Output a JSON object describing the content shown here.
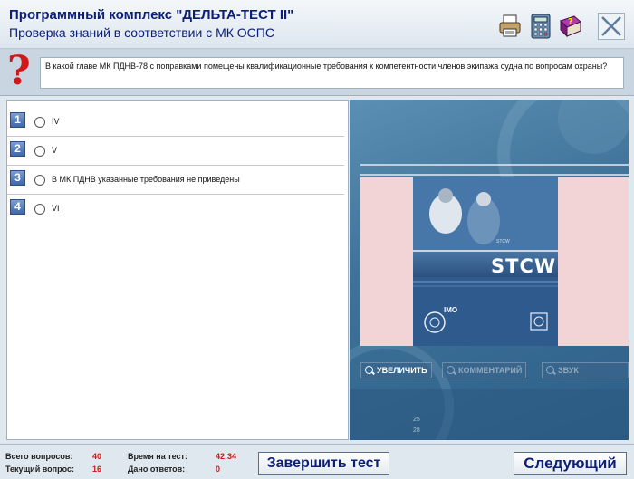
{
  "header": {
    "title": "Программный комплекс \"ДЕЛЬТА-ТЕСТ II\"",
    "subtitle": "Проверка знаний в соответствии с МК ОСПС"
  },
  "question": {
    "text": "В какой главе МК ПДНВ-78 с поправками помещены квалификационные требования к компетентности членов экипажа судна по вопросам охраны?"
  },
  "answers": [
    {
      "num": "1",
      "text": "IV"
    },
    {
      "num": "2",
      "text": "V"
    },
    {
      "num": "3",
      "text": "В МК ПДНВ указанные требования не приведены"
    },
    {
      "num": "4",
      "text": "VI"
    }
  ],
  "image_panel": {
    "cover_title": "STCW",
    "cover_org": "IMO",
    "cover_small": "STCW",
    "buttons": {
      "zoom": "УВЕЛИЧИТЬ",
      "comment": "КОММЕНТАРИЙ",
      "sound": "ЗВУК"
    },
    "colors": {
      "zoom_active": "#ffffff",
      "disabled": "#8ea8bd"
    },
    "deco_numbers": [
      "25",
      "28"
    ]
  },
  "status": {
    "total_label": "Всего вопросов:",
    "total_value": "40",
    "current_label": "Текущий вопрос:",
    "current_value": "16",
    "time_label": "Время на тест:",
    "time_value": "42:34",
    "answered_label": "Дано ответов:",
    "answered_value": "0",
    "finish_button": "Завершить тест",
    "next_button": "Следующий"
  },
  "icons": [
    "printer-icon",
    "calculator-icon",
    "help-book-icon",
    "close-icon",
    "question-mark-icon"
  ]
}
